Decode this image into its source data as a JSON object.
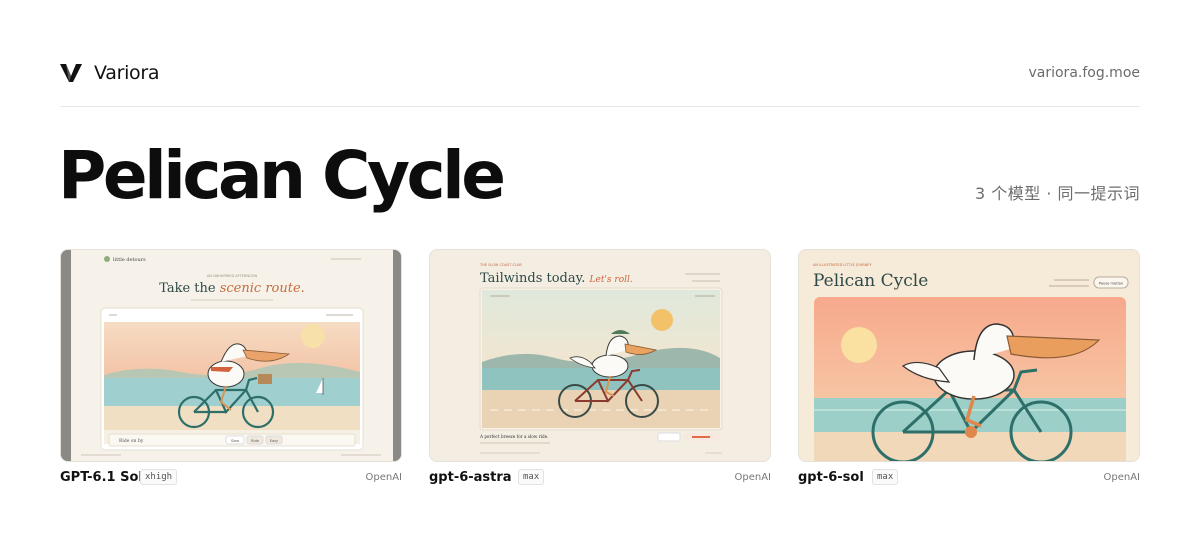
{
  "header": {
    "brand_name": "Variora",
    "site_link": "variora.fog.moe",
    "logo_icon": "variora-v-logo"
  },
  "page": {
    "title": "Pelican Cycle",
    "subtitle": "3 个模型 · 同一提示词"
  },
  "cards": [
    {
      "model": "GPT-6.1 Sol",
      "effort": "xhigh",
      "provider": "OpenAI",
      "preview": {
        "brand": "little detours",
        "eyebrow": "AN UNHURRIED AFTERNOON",
        "headline_plain": "Take the ",
        "headline_italic": "scenic route.",
        "caption": "Ride on by",
        "chips": [
          "Slow",
          "Ride",
          "Easy"
        ]
      }
    },
    {
      "model": "gpt-6-astra",
      "effort": "max",
      "provider": "OpenAI",
      "preview": {
        "eyebrow": "THE SLOW COAST CLUB",
        "headline_plain": "Tailwinds today. ",
        "headline_italic": "Let's roll.",
        "caption": "A perfect breeze for a slow ride."
      }
    },
    {
      "model": "gpt-6-sol",
      "effort": "max",
      "provider": "OpenAI",
      "preview": {
        "eyebrow": "AN ILLUSTRATED LITTLE JOURNEY",
        "headline_plain": "Pelican Cycle",
        "button": "Pause motion"
      }
    }
  ],
  "colors": {
    "sky_peach": "#f3c7a6",
    "sky_cream": "#f7e6cc",
    "sea_teal": "#8fc4c0",
    "sand": "#f0dcc0",
    "bike_teal": "#2f6f6a",
    "accent_orange": "#e38b4f"
  }
}
